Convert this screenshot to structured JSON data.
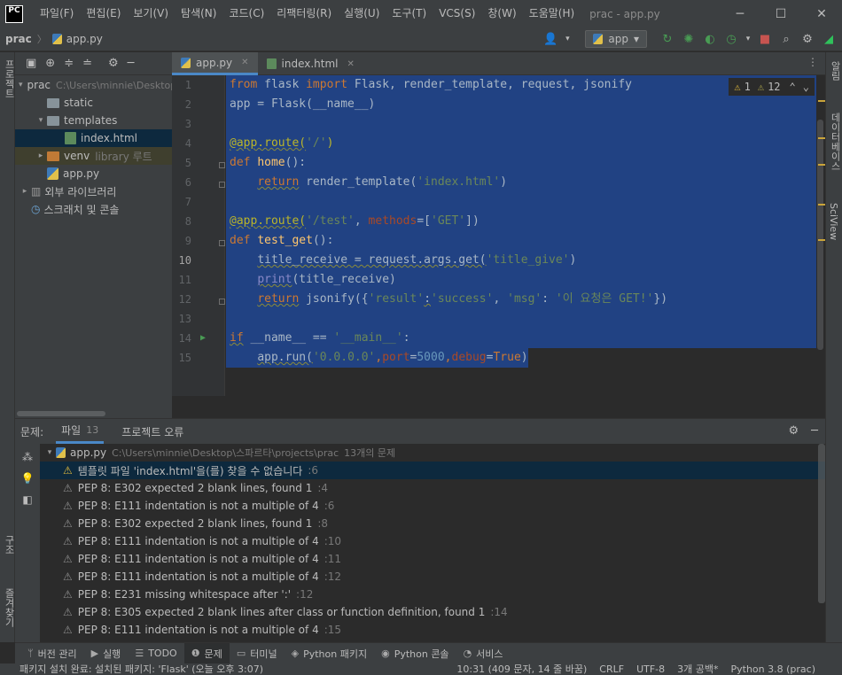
{
  "app": {
    "logo_text": "PC",
    "window_title": "prac - app.py"
  },
  "menu": [
    "파일(F)",
    "편집(E)",
    "보기(V)",
    "탐색(N)",
    "코드(C)",
    "리팩터링(R)",
    "실행(U)",
    "도구(T)",
    "VCS(S)",
    "창(W)",
    "도움말(H)"
  ],
  "window_controls": {
    "minimize": "─",
    "maximize": "☐",
    "close": "✕"
  },
  "breadcrumb": {
    "project": "prac",
    "file": "app.py"
  },
  "run_config": {
    "name": "app",
    "arrow": "▾"
  },
  "left_strip": {
    "project_label": "프로젝트",
    "structure_label": "구조",
    "favorites_label": "즐겨찾기"
  },
  "right_strip": {
    "db_label": "데이터베이스",
    "sciview_label": "SciView",
    "notifications_label": "알림"
  },
  "project_tree": [
    {
      "label": "prac",
      "extra": "C:\\Users\\minnie\\Desktop\\스파르타\\projects\\prac",
      "indent": 0,
      "arrow": "▾",
      "icon": "folder"
    },
    {
      "label": "static",
      "extra": "",
      "indent": 1,
      "arrow": "",
      "icon": "folder"
    },
    {
      "label": "templates",
      "extra": "",
      "indent": 1,
      "arrow": "▾",
      "icon": "folder"
    },
    {
      "label": "index.html",
      "extra": "",
      "indent": 2,
      "arrow": "",
      "icon": "html",
      "selected": true
    },
    {
      "label": "venv",
      "extra": "library 루트",
      "indent": 1,
      "arrow": "▸",
      "icon": "folder-excluded"
    },
    {
      "label": "app.py",
      "extra": "",
      "indent": 1,
      "arrow": "",
      "icon": "py"
    },
    {
      "label": "외부 라이브러리",
      "extra": "",
      "indent": 0,
      "arrow": "▸",
      "icon": "library"
    },
    {
      "label": "스크래치 및 콘솔",
      "extra": "",
      "indent": 0,
      "arrow": "",
      "icon": "scratch"
    }
  ],
  "editor_tabs": [
    {
      "label": "app.py",
      "active": true
    },
    {
      "label": "index.html",
      "active": false
    }
  ],
  "inspections": {
    "warnings": "1",
    "weak_warnings": "12"
  },
  "code": {
    "line_numbers": [
      "1",
      "2",
      "3",
      "4",
      "5",
      "6",
      "7",
      "8",
      "9",
      "10",
      "11",
      "12",
      "13",
      "14",
      "15"
    ],
    "current_line": "10",
    "l1": {
      "kw_from": "from",
      "mod": " flask ",
      "kw_import": "import",
      "names": " Flask, render_template, request, jsonify"
    },
    "l2": {
      "text": "app = Flask(__name__)"
    },
    "l4": {
      "dec": "@app.route(",
      "str": "'/'",
      "close": ")"
    },
    "l5": {
      "kw": "def ",
      "fn": "home",
      "rest": "():"
    },
    "l6": {
      "indent": "    ",
      "kw": "return",
      "call": " render_template(",
      "str": "'index.html'",
      "close": ")"
    },
    "l8": {
      "dec": "@app.route(",
      "str": "'/test'",
      "sep": ", ",
      "param": "methods",
      "eq": "=[",
      "str2": "'GET'",
      "close": "])"
    },
    "l9": {
      "kw": "def ",
      "fn": "test_get",
      "rest": "():"
    },
    "l10": {
      "indent": "    ",
      "text": "title_receive = request.args.get(",
      "str": "'title_give'",
      "close": ")"
    },
    "l11": {
      "indent": "    ",
      "bi": "print",
      "rest": "(title_receive)"
    },
    "l12": {
      "indent": "    ",
      "kw": "return",
      "call": " jsonify({",
      "s1": "'result'",
      "colon": ":",
      "s2": "'success'",
      "sep": ", ",
      "s3": "'msg'",
      "colon2": ": ",
      "s4": "'이 요청은 GET!'",
      "close": "})"
    },
    "l14": {
      "kw": "if",
      "rest": " __name__ == ",
      "str": "'__main__'",
      "colon": ":"
    },
    "l15": {
      "indent": "    ",
      "call": "app.run(",
      "s1": "'0.0.0.0'",
      "c1": ",",
      "p1": "port",
      "eq1": "=",
      "n1": "5000",
      "c2": ",",
      "p2": "debug",
      "eq2": "=",
      "kw": "True",
      "close": ")"
    }
  },
  "problems": {
    "title": "문제:",
    "tabs": [
      {
        "label": "파일",
        "count": "13",
        "active": true
      },
      {
        "label": "프로젝트 오류",
        "count": "",
        "active": false
      }
    ],
    "file": {
      "name": "app.py",
      "path": "C:\\Users\\minnie\\Desktop\\스파르타\\projects\\prac",
      "summary": "13개의 문제"
    },
    "items": [
      {
        "text": "템플릿 파일 'index.html'을(를) 찾을 수 없습니다",
        "loc": ":6",
        "selected": true
      },
      {
        "text": "PEP 8: E302 expected 2 blank lines, found 1",
        "loc": ":4"
      },
      {
        "text": "PEP 8: E111 indentation is not a multiple of 4",
        "loc": ":6"
      },
      {
        "text": "PEP 8: E302 expected 2 blank lines, found 1",
        "loc": ":8"
      },
      {
        "text": "PEP 8: E111 indentation is not a multiple of 4",
        "loc": ":10"
      },
      {
        "text": "PEP 8: E111 indentation is not a multiple of 4",
        "loc": ":11"
      },
      {
        "text": "PEP 8: E111 indentation is not a multiple of 4",
        "loc": ":12"
      },
      {
        "text": "PEP 8: E231 missing whitespace after ':'",
        "loc": ":12"
      },
      {
        "text": "PEP 8: E305 expected 2 blank lines after class or function definition, found 1",
        "loc": ":14"
      },
      {
        "text": "PEP 8: E111 indentation is not a multiple of 4",
        "loc": ":15"
      }
    ]
  },
  "bottom_tools": [
    {
      "label": "버전 관리",
      "icon": "ᛘ"
    },
    {
      "label": "실행",
      "icon": "▶"
    },
    {
      "label": "TODO",
      "icon": "☰"
    },
    {
      "label": "문제",
      "icon": "❶",
      "active": true
    },
    {
      "label": "터미널",
      "icon": "▭"
    },
    {
      "label": "Python 패키지",
      "icon": "◈"
    },
    {
      "label": "Python 콘솔",
      "icon": "◉"
    },
    {
      "label": "서비스",
      "icon": "◔"
    }
  ],
  "status": {
    "message": "패키지 설치 완료: 설치된 패키지: 'Flask' (오늘 오후 3:07)",
    "position": "10:31 (409 문자, 14 줄 바꿈)",
    "line_sep": "CRLF",
    "encoding": "UTF-8",
    "indent": "3개 공백*",
    "interpreter": "Python 3.8 (prac)"
  }
}
